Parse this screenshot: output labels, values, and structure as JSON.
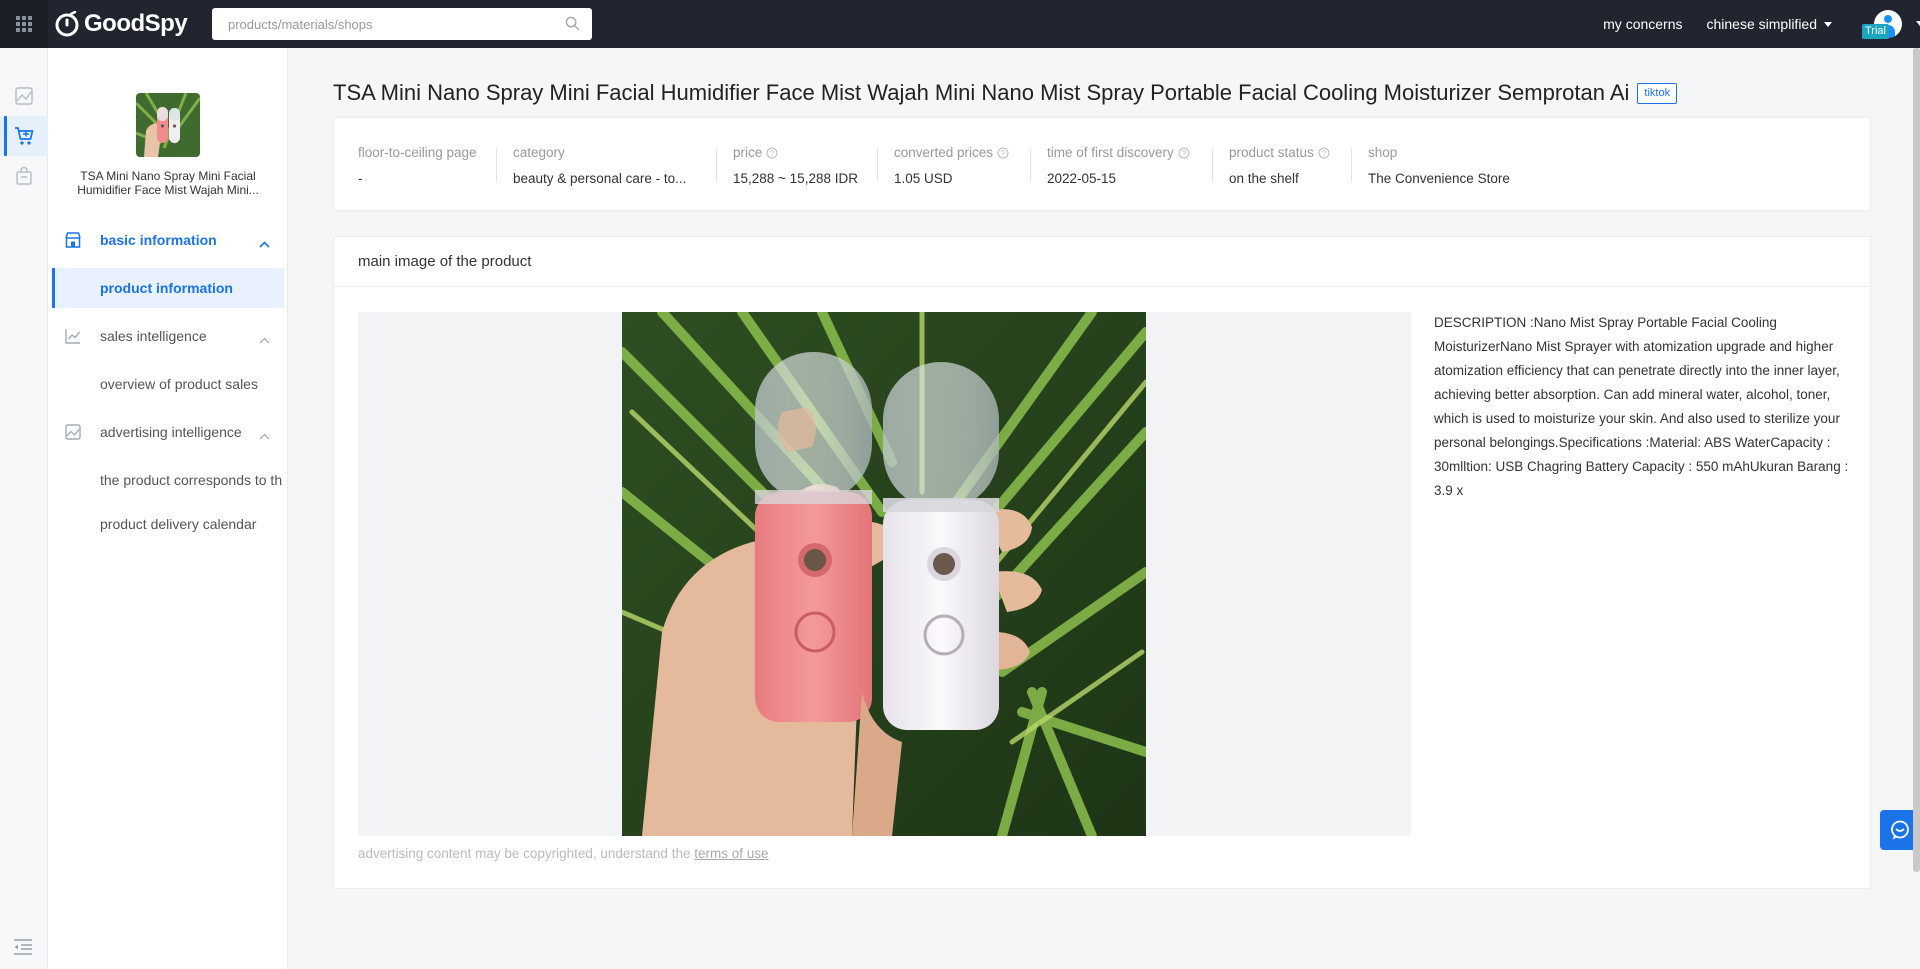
{
  "topbar": {
    "logo_text": "GoodSpy",
    "search_placeholder": "products/materials/shops",
    "my_concerns": "my concerns",
    "language": "chinese simplified",
    "trial_badge": "Trial"
  },
  "sidebar": {
    "product_title": "TSA Mini Nano Spray Mini Facial Humidifier Face Mist Wajah Mini...",
    "groups": [
      {
        "label": "basic information",
        "icon": "store-icon",
        "expanded": true,
        "active": true
      },
      {
        "label": "sales intelligence",
        "icon": "trend-chart-icon",
        "expanded": true,
        "active": false
      },
      {
        "label": "advertising intelligence",
        "icon": "ad-image-icon",
        "expanded": true,
        "active": false
      }
    ],
    "items": [
      {
        "label": "product information",
        "active": true
      },
      {
        "label": "overview of product sales",
        "active": false
      },
      {
        "label": "the product corresponds to th",
        "active": false
      },
      {
        "label": "product delivery calendar",
        "active": false
      }
    ]
  },
  "page": {
    "title": "TSA Mini Nano Spray Mini Facial Humidifier Face Mist Wajah Mini Nano Mist Spray Portable Facial Cooling Moisturizer Semprotan Ai",
    "platform_tag": "tiktok"
  },
  "info": [
    {
      "label": "floor-to-ceiling page",
      "value": "-",
      "help": false
    },
    {
      "label": "category",
      "value": "beauty & personal care - to...",
      "help": false
    },
    {
      "label": "price",
      "value": "15,288 ~ 15,288 IDR",
      "help": true
    },
    {
      "label": "converted prices",
      "value": "1.05 USD",
      "help": true
    },
    {
      "label": "time of first discovery",
      "value": "2022-05-15",
      "help": true
    },
    {
      "label": "product status",
      "value": "on the shelf",
      "help": true
    },
    {
      "label": "shop",
      "value": "The Convenience Store",
      "help": false
    }
  ],
  "main_image": {
    "section_title": "main image of the product",
    "description": "DESCRIPTION :Nano Mist Spray Portable Facial Cooling MoisturizerNano Mist Sprayer with atomization upgrade and higher atomization efficiency that can penetrate directly into the inner layer, achieving better absorption. Can add mineral water, alcohol, toner, which is used to moisturize your skin. And also used to sterilize your personal belongings.Specifications :Material: ABS WaterCapacity : 30mlltion: USB Chagring Battery Capacity : 550 mAhUkuran Barang : 3.9 x",
    "copyright_note": "advertising content may be copyrighted, understand the",
    "terms_link": "terms of use"
  },
  "colors": {
    "topbar_bg": "#20252f",
    "accent": "#1a73e8",
    "active_bg": "#e8f1fd"
  }
}
